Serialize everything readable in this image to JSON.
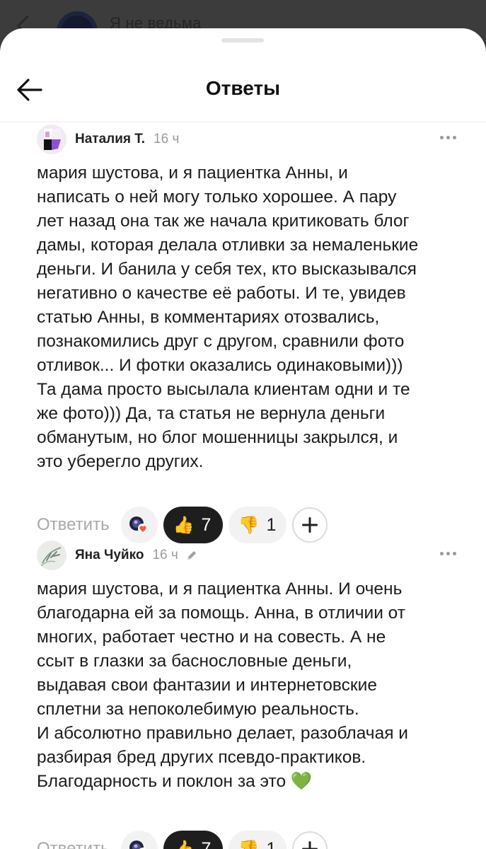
{
  "behind": {
    "title": "Я не ведьма"
  },
  "header": {
    "title": "Ответы"
  },
  "comments": [
    {
      "author": "Наталия Т.",
      "time": "16 ч",
      "edited": false,
      "text": "мария шустова, и я пациентка Анны, и\nнаписать о ней могу только хорошее. А пару\nлет назад она так же начала критиковать блог\nдамы, которая делала отливки за немаленькие\nденьги. И банила у себя тех, кто высказывался\nнегативно о качестве её работы. И те, увидев\nстатью  Анны, в комментариях отозвались,\nпознакомились друг с другом, сравнили фото\nотливок... И фотки оказались одинаковыми)))\nТа дама просто высылала клиентам одни и те\nже фото))) Да, та статья не вернула деньги\nобманутым, но блог мошенницы закрылся, и\nэто уберегло других.",
      "reply_label": "Ответить",
      "likes": "7",
      "dislikes": "1"
    },
    {
      "author": "Яна Чуйко",
      "time": "16 ч",
      "edited": true,
      "text": "мария шустова, и я пациентка Анны. И очень\nблагодарна ей за помощь. Анна, в отличии от\nмногих, работает честно и на совесть. А не\nссыт в глазки за баснословные деньги,\nвыдавая свои фантазии и интернетовские\nсплетни за непоколебимую реальность.\nИ абсолютно правильно делает, разоблачая и\nразбирая бред других псевдо-практиков.\nБлагодарность и поклон за это 💚",
      "reply_label": "Ответить",
      "likes": "7",
      "dislikes": "1"
    }
  ],
  "icons": {
    "like": "thumbs-up-icon",
    "dislike": "thumbs-down-icon",
    "add_reaction": "plus-icon",
    "more": "more-dots-icon",
    "edited": "pencil-icon",
    "back": "arrow-left-icon"
  }
}
